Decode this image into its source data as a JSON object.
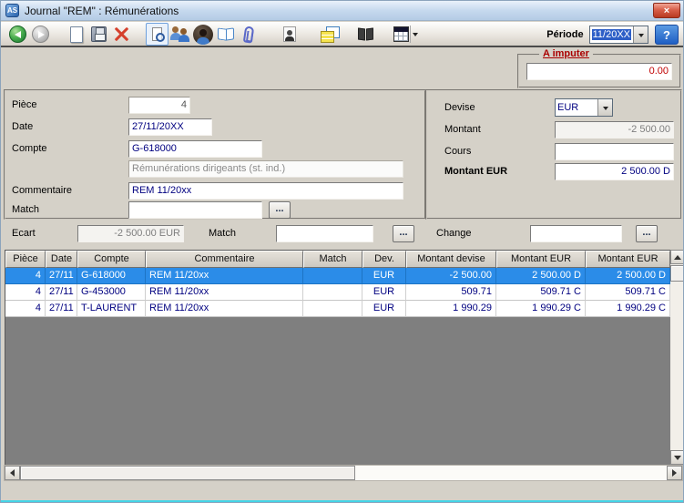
{
  "window": {
    "title": "Journal \"REM\" : Rémunérations",
    "app_icon_text": "AS"
  },
  "glyphs": {
    "close": "×",
    "ellipsis": "..."
  },
  "toolbar": {
    "periode_label": "Période",
    "periode_value": "11/20XX",
    "help_label": "?",
    "icons": [
      "back",
      "forward",
      "new-document",
      "save",
      "delete",
      "print-preview",
      "contacts-group",
      "person",
      "catalog-book",
      "attachment",
      "person-photo",
      "report-list",
      "ledger-book",
      "table-view-dropdown"
    ]
  },
  "imputer": {
    "label": "A imputer",
    "value": "0.00"
  },
  "form": {
    "piece_label": "Pièce",
    "piece_value": "4",
    "date_label": "Date",
    "date_value": "27/11/20XX",
    "compte_label": "Compte",
    "compte_value": "G-618000",
    "compte_name": "Rémunérations dirigeants (st. ind.)",
    "commentaire_label": "Commentaire",
    "commentaire_value": "REM 11/20xx",
    "match_label": "Match",
    "match_value": "",
    "devise_label": "Devise",
    "devise_value": "EUR",
    "montant_label": "Montant",
    "montant_value": "-2 500.00",
    "cours_label": "Cours",
    "cours_value": "",
    "montant_eur_label": "Montant EUR",
    "montant_eur_value": "2 500.00 D"
  },
  "ecart": {
    "label": "Ecart",
    "value": "-2 500.00 EUR",
    "match_label": "Match",
    "match_value": "",
    "change_label": "Change",
    "change_value": ""
  },
  "table": {
    "columns": [
      "Pièce",
      "Date",
      "Compte",
      "Commentaire",
      "Match",
      "Dev.",
      "Montant devise",
      "Montant EUR",
      "Montant EUR"
    ],
    "rows": [
      [
        "4",
        "27/11",
        "G-618000",
        "REM 11/20xx",
        "",
        "EUR",
        "-2 500.00",
        "2 500.00 D",
        "2 500.00 D"
      ],
      [
        "4",
        "27/11",
        "G-453000",
        "REM 11/20xx",
        "",
        "EUR",
        "509.71",
        "509.71 C",
        "509.71 C"
      ],
      [
        "4",
        "27/11",
        "T-LAURENT",
        "REM 11/20xx",
        "",
        "EUR",
        "1 990.29",
        "1 990.29 C",
        "1 990.29 C"
      ]
    ],
    "selected_row": 0
  },
  "colors": {
    "selection_blue": "#2b8ce8",
    "error_red": "#c00000",
    "navy_text": "#000080",
    "window_edge_cyan": "#44d4e6"
  }
}
